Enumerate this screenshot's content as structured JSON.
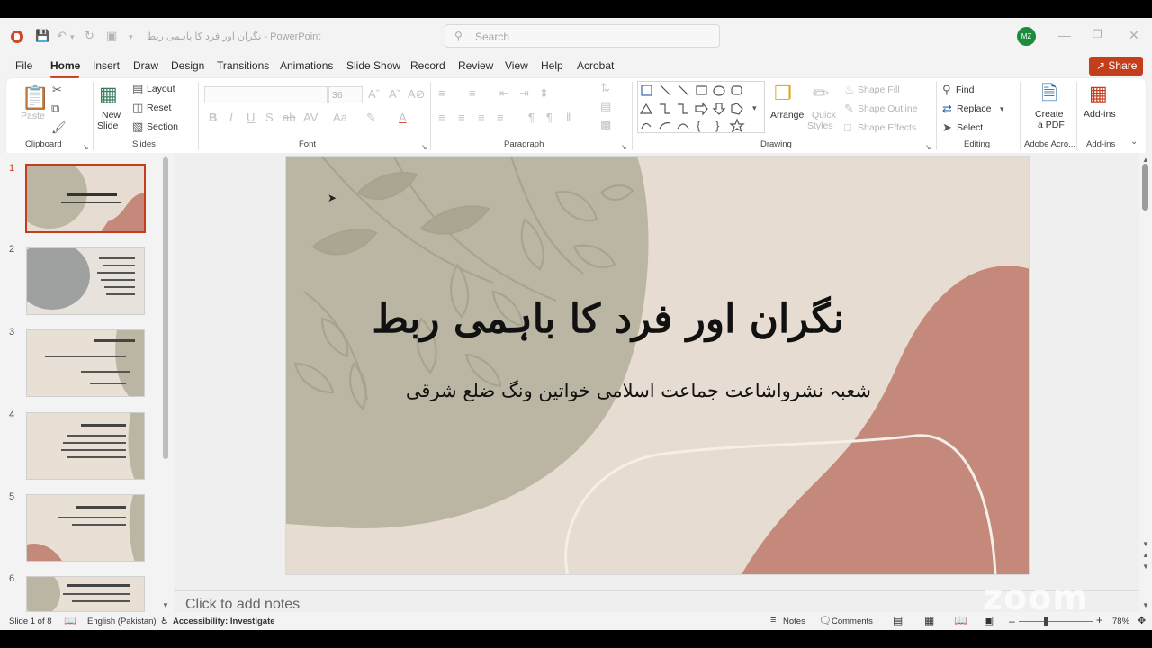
{
  "titlebar": {
    "doc_title": "نگران اور فرد کا باہمی ربط  -  PowerPoint",
    "search_placeholder": "Search",
    "avatar_initials": "MZ"
  },
  "tabs": [
    "File",
    "Home",
    "Insert",
    "Draw",
    "Design",
    "Transitions",
    "Animations",
    "Slide Show",
    "Record",
    "Review",
    "View",
    "Help",
    "Acrobat"
  ],
  "active_tab": "Home",
  "share_label": "Share",
  "ribbon": {
    "clipboard": {
      "label": "Clipboard",
      "paste": "Paste"
    },
    "slides": {
      "label": "Slides",
      "new_slide_1": "New",
      "new_slide_2": "Slide",
      "layout": "Layout",
      "reset": "Reset",
      "section": "Section"
    },
    "font": {
      "label": "Font",
      "size": "36"
    },
    "paragraph": {
      "label": "Paragraph"
    },
    "drawing": {
      "label": "Drawing",
      "arrange": "Arrange",
      "quick_styles_1": "Quick",
      "quick_styles_2": "Styles",
      "shape_fill": "Shape Fill",
      "shape_outline": "Shape Outline",
      "shape_effects": "Shape Effects"
    },
    "editing": {
      "label": "Editing",
      "find": "Find",
      "replace": "Replace",
      "select": "Select"
    },
    "adobe": {
      "label": "Adobe Acro...",
      "create_1": "Create",
      "create_2": "a PDF"
    },
    "addins": {
      "label": "Add-ins",
      "addins": "Add-ins"
    }
  },
  "slide": {
    "title": "نگران اور فرد کا باہمی ربط",
    "subtitle": "شعبہ نشرواشاعت جماعت اسلامی خواتین ونگ ضلع شرقی"
  },
  "thumbnails": [
    "1",
    "2",
    "3",
    "4",
    "5",
    "6"
  ],
  "notes_placeholder": "Click to add notes",
  "status": {
    "slide": "Slide 1 of 8",
    "language": "English (Pakistan)",
    "accessibility": "Accessibility: Investigate",
    "notes": "Notes",
    "comments": "Comments",
    "zoom": "78%"
  },
  "watermark": "zoom",
  "colors": {
    "accent": "#c43e1c",
    "slide_bg": "#e7dcd1",
    "olive": "#bbb6a3",
    "rose": "#c4897b"
  }
}
